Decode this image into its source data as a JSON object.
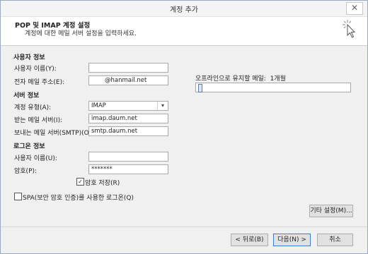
{
  "window": {
    "title": "계정 추가",
    "close_glyph": "✕"
  },
  "header": {
    "title": "POP 및 IMAP 계정 설정",
    "subtitle": "계정에 대한 메일 서버 설정을 입력하세요."
  },
  "user_info": {
    "section": "사용자 정보",
    "name_label": "사용자 이름(Y):",
    "name_value": "",
    "email_label": "전자 메일 주소(E):",
    "email_value": "@hanmail.net"
  },
  "server_info": {
    "section": "서버 정보",
    "type_label": "계정 유형(A):",
    "type_value": "IMAP",
    "incoming_label": "받는 메일 서버(I):",
    "incoming_value": "imap.daum.net",
    "outgoing_label": "보내는 메일 서버(SMTP)(O):",
    "outgoing_value": "smtp.daum.net"
  },
  "login_info": {
    "section": "로그온 정보",
    "user_label": "사용자 이름(U):",
    "user_value": "",
    "password_label": "암호(P):",
    "password_value": "*******",
    "remember_label": "암호 저장(R)",
    "remember_checked": true,
    "spa_label": "SPA(보안 암호 인증)를 사용한 로그온(Q)",
    "spa_checked": false
  },
  "offline": {
    "label": "오프라인으로 유지할 메일:",
    "value": "1개월",
    "slider_level": 0
  },
  "buttons": {
    "more_settings": "기타 설정(M)...",
    "back": "< 뒤로(B)",
    "next": "다음(N) >",
    "cancel": "취소"
  },
  "icons": {
    "cursor": "click-cursor-icon",
    "close": "close-icon",
    "dropdown": "chevron-down-icon",
    "check": "✓"
  }
}
